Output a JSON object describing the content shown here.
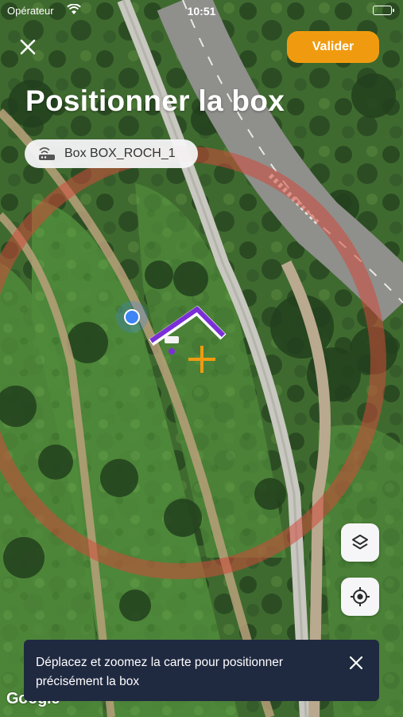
{
  "status_bar": {
    "carrier": "Opérateur",
    "time": "10:51"
  },
  "header": {
    "title": "Positionner la box",
    "validate_label": "Valider",
    "close_icon": "close-icon"
  },
  "box_chip": {
    "label": "Box BOX_ROCH_1",
    "icon": "router-icon"
  },
  "map_controls": {
    "layers_icon": "layers-icon",
    "locate_icon": "crosshair-icon"
  },
  "toast": {
    "message": "Déplacez et zoomez la carte pour positionner précisément la box",
    "close_icon": "close-icon"
  },
  "map": {
    "attribution": "Google",
    "accent_color": "#f09b0f",
    "marker_color": "#7b2fd6",
    "user_location_color": "#3d84f5"
  }
}
